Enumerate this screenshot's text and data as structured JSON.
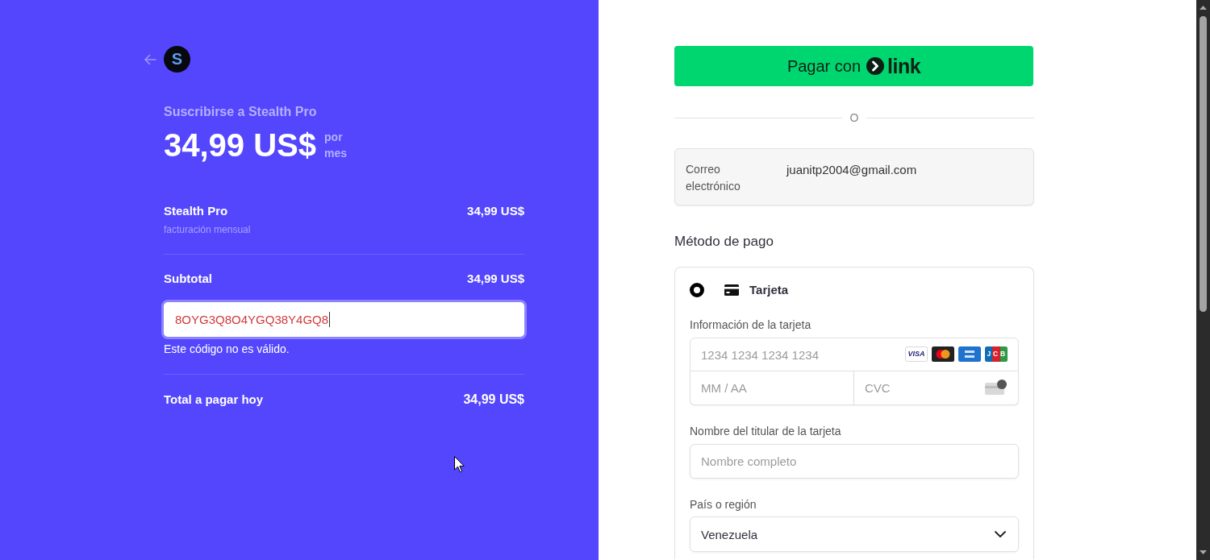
{
  "summary": {
    "logo_text": "S",
    "title": "Suscribirse a Stealth Pro",
    "price": "34,99 US$",
    "period": "por mes",
    "line_items": [
      {
        "name": "Stealth Pro",
        "detail": "facturación mensual",
        "amount": "34,99 US$"
      }
    ],
    "subtotal": {
      "label": "Subtotal",
      "amount": "34,99 US$"
    },
    "promo_code": {
      "value": "8OYG3Q8O4YGQ38Y4GQ8",
      "focused": true,
      "invalid": true,
      "error": "Este código no es válido."
    },
    "total": {
      "label": "Total a pagar hoy",
      "amount": "34,99 US$"
    }
  },
  "checkout": {
    "link_button": {
      "label": "Pagar con",
      "brand": "link"
    },
    "divider_text": "O",
    "email": {
      "label": "Correo electrónico",
      "value": "juanitp2004@gmail.com"
    },
    "payment_method": {
      "heading": "Método de pago",
      "options": [
        {
          "label": "Tarjeta",
          "selected": true
        }
      ],
      "card": {
        "label": "Información de la tarjeta",
        "number_placeholder": "1234 1234 1234 1234",
        "brands": [
          {
            "kind": "visa",
            "text": "VISA"
          },
          {
            "kind": "mastercard"
          },
          {
            "kind": "amex"
          },
          {
            "kind": "jcb",
            "text": "JCB"
          }
        ],
        "expiry_placeholder": "MM / AA",
        "cvc_placeholder": "CVC"
      },
      "cardholder": {
        "label": "Nombre del titular de la tarjeta",
        "placeholder": "Nombre completo"
      },
      "country": {
        "label": "País o región",
        "value": "Venezuela"
      }
    }
  }
}
